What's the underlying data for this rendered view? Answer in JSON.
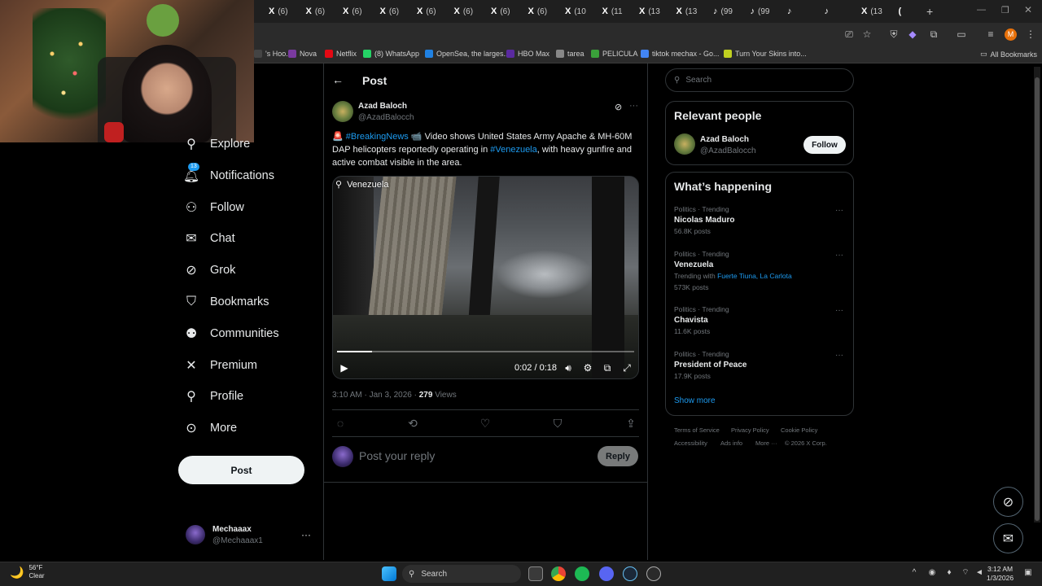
{
  "browser": {
    "tabs": [
      {
        "icon": "X",
        "label": "(6)"
      },
      {
        "icon": "X",
        "label": "(6)"
      },
      {
        "icon": "X",
        "label": "(6)"
      },
      {
        "icon": "X",
        "label": "(6)"
      },
      {
        "icon": "X",
        "label": "(6)"
      },
      {
        "icon": "X",
        "label": "(6)"
      },
      {
        "icon": "X",
        "label": "(6)"
      },
      {
        "icon": "X",
        "label": "(6)"
      },
      {
        "icon": "X",
        "label": "(10"
      },
      {
        "icon": "X",
        "label": "(11"
      },
      {
        "icon": "X",
        "label": "(13"
      },
      {
        "icon": "X",
        "label": "(13"
      },
      {
        "icon": "♪",
        "label": "(99"
      },
      {
        "icon": "♪",
        "label": "(99"
      },
      {
        "icon": "♪",
        "label": ""
      },
      {
        "icon": "♪",
        "label": ""
      },
      {
        "icon": "X",
        "label": "(13"
      },
      {
        "icon": "(",
        "label": ""
      }
    ],
    "bookmarks": [
      {
        "label": "'s Hoo...",
        "color": "#444"
      },
      {
        "label": "Nova",
        "color": "#7a3aa0"
      },
      {
        "label": "Netflix",
        "color": "#e50914"
      },
      {
        "label": "(8) WhatsApp",
        "color": "#25d366"
      },
      {
        "label": "OpenSea, the larges...",
        "color": "#2081e2"
      },
      {
        "label": "HBO Max",
        "color": "#5a2aa0"
      },
      {
        "label": "tarea",
        "color": "#888"
      },
      {
        "label": "PELICULA",
        "color": "#3aa03a"
      },
      {
        "label": "tiktok mechax - Go...",
        "color": "#4285f4"
      },
      {
        "label": "Turn Your Skins into...",
        "color": "#c0d020"
      }
    ],
    "all_bookmarks": "All Bookmarks",
    "profile_initial": "M"
  },
  "nav": {
    "items": [
      {
        "label": "Explore",
        "icon": "search-icon"
      },
      {
        "label": "Notifications",
        "icon": "bell-icon",
        "badge": "13"
      },
      {
        "label": "Follow",
        "icon": "person-add-icon"
      },
      {
        "label": "Chat",
        "icon": "mail-icon"
      },
      {
        "label": "Grok",
        "icon": "grok-icon"
      },
      {
        "label": "Bookmarks",
        "icon": "bookmark-icon"
      },
      {
        "label": "Communities",
        "icon": "people-icon"
      },
      {
        "label": "Premium",
        "icon": "x-logo-icon"
      },
      {
        "label": "Profile",
        "icon": "person-icon"
      },
      {
        "label": "More",
        "icon": "more-circle-icon"
      }
    ],
    "post_button": "Post",
    "account": {
      "name": "Mechaaax",
      "handle": "@Mechaaax1"
    }
  },
  "post": {
    "header": "Post",
    "author": {
      "name": "Azad Baloch",
      "handle": "@AzadBalocch"
    },
    "text_parts": {
      "siren": "🚨",
      "tag1": "#BreakingNews",
      "camera": "📹",
      "t1": " Video shows United States Army Apache & MH-60M DAP helicopters reportedly operating in ",
      "tag2": "#Venezuela",
      "t2": ", with heavy gunfire and active combat visible in the area."
    },
    "video": {
      "location": "Venezuela",
      "time": "0:02 / 0:18",
      "progress": 0.118
    },
    "meta": {
      "time": "3:10 AM · Jan 3, 2026 · ",
      "views_count": "279",
      "views_label": " Views"
    },
    "reply_placeholder": "Post your reply",
    "reply_button": "Reply"
  },
  "sidebar": {
    "search_placeholder": "Search",
    "relevant_title": "Relevant people",
    "relevant": {
      "name": "Azad Baloch",
      "handle": "@AzadBalocch",
      "follow": "Follow"
    },
    "happening_title": "What’s happening",
    "trends": [
      {
        "category": "Politics · Trending",
        "name": "Nicolas Maduro",
        "posts": "56.8K posts"
      },
      {
        "category": "Politics · Trending",
        "name": "Venezuela",
        "with_label": "Trending with ",
        "with_links": "Fuerte Tiuna, La Carlota",
        "posts": "573K posts"
      },
      {
        "category": "Politics · Trending",
        "name": "Chavista",
        "posts": "11.6K posts"
      },
      {
        "category": "Politics · Trending",
        "name": "President of Peace",
        "posts": "17.9K posts"
      }
    ],
    "show_more": "Show more",
    "footer": [
      "Terms of Service",
      "Privacy Policy",
      "Cookie Policy",
      "Accessibility",
      "Ads info",
      "More ···",
      "© 2026 X Corp."
    ]
  },
  "taskbar": {
    "weather_temp": "56°F",
    "weather_desc": "Clear",
    "search": "Search",
    "time": "3:12 AM",
    "date": "1/3/2026"
  }
}
